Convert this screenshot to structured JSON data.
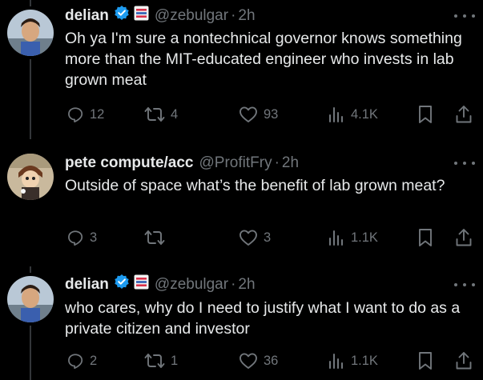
{
  "tweets": [
    {
      "author": "delian",
      "handle": "@zebulgar",
      "time": "2h",
      "verified": true,
      "flag_icon": "flag-emoji-icon",
      "avatar_icon": "boy-photo-avatar",
      "text": "Oh ya I'm sure a nontechnical governor knows something more than the MIT-educated engineer who invests in lab grown meat",
      "replies": "12",
      "retweets": "4",
      "likes": "93",
      "views": "4.1K"
    },
    {
      "author": "pete compute/acc",
      "handle": "@ProfitFry",
      "time": "2h",
      "verified": false,
      "avatar_icon": "anime-character-avatar",
      "text": "Outside of space what’s the benefit of lab grown meat?",
      "replies": "3",
      "retweets": "",
      "likes": "3",
      "views": "1.1K"
    },
    {
      "author": "delian",
      "handle": "@zebulgar",
      "time": "2h",
      "verified": true,
      "flag_icon": "flag-emoji-icon",
      "avatar_icon": "boy-photo-avatar",
      "text": "who cares, why do I need to justify what I want to do as a private citizen and investor",
      "replies": "2",
      "retweets": "1",
      "likes": "36",
      "views": "1.1K"
    }
  ],
  "separator": "·",
  "colors": {
    "background": "#000000",
    "text": "#e7e9ea",
    "muted": "#71767b",
    "verified": "#1d9bf0",
    "thread_line": "#333639"
  }
}
